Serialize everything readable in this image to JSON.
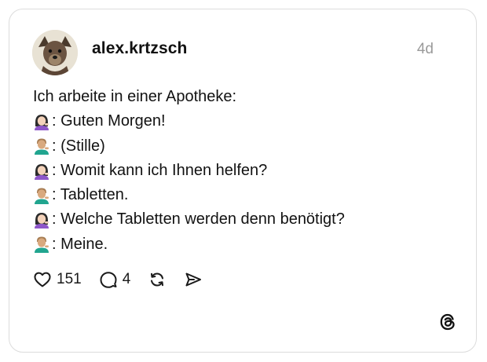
{
  "post": {
    "username": "alex.krtzsch",
    "time": "4d",
    "avatar_icon": "dog-avatar",
    "lines": [
      {
        "speaker": "none",
        "text": "Ich arbeite in einer Apotheke:"
      },
      {
        "speaker": "woman-tipping-hand",
        "text": ": Guten Morgen!"
      },
      {
        "speaker": "man-tipping-hand",
        "text": ": (Stille)"
      },
      {
        "speaker": "woman-tipping-hand",
        "text": ": Womit kann ich Ihnen helfen?"
      },
      {
        "speaker": "man-tipping-hand",
        "text": ": Tabletten."
      },
      {
        "speaker": "woman-tipping-hand",
        "text": ": Welche Tabletten werden denn benötigt?"
      },
      {
        "speaker": "man-tipping-hand",
        "text": ": Meine."
      }
    ],
    "likes": "151",
    "replies": "4"
  },
  "colors": {
    "border": "#dcdcdc",
    "time": "#9a9a9a",
    "text": "#121212"
  },
  "icons": [
    "heart-icon",
    "reply-bubble-icon",
    "repost-icon",
    "share-send-icon",
    "threads-logo-icon"
  ]
}
